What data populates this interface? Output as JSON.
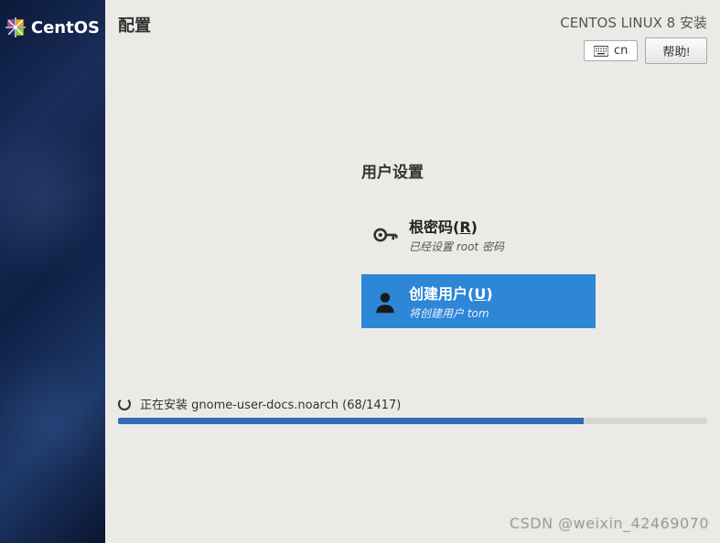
{
  "brand": {
    "name": "CentOS"
  },
  "header": {
    "page_title": "配置",
    "product": "CENTOS LINUX 8 安装",
    "language_code": "cn",
    "help_label": "帮助!"
  },
  "user_settings": {
    "section_title": "用户设置",
    "spokes": [
      {
        "id": "root-password",
        "icon": "key-icon",
        "title_prefix": "根密码(",
        "title_shortcut": "R",
        "title_suffix": ")",
        "status": "已经设置 root 密码",
        "selected": false
      },
      {
        "id": "create-user",
        "icon": "user-icon",
        "title_prefix": "创建用户(",
        "title_shortcut": "U",
        "title_suffix": ")",
        "status": "将创建用户 tom",
        "selected": true
      }
    ]
  },
  "progress": {
    "text": "正在安装 gnome-user-docs.noarch (68/1417)",
    "percent": 79
  },
  "watermark": "CSDN @weixin_42469070"
}
